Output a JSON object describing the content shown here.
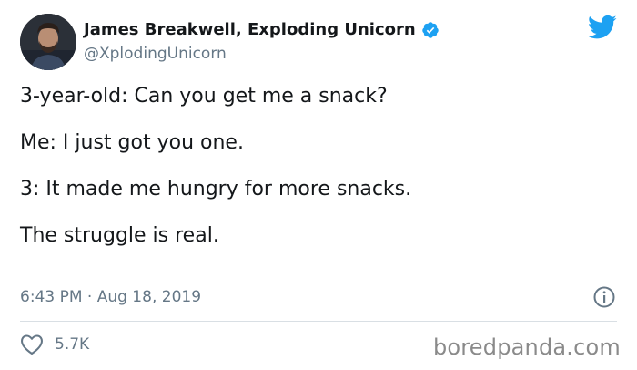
{
  "author": {
    "display_name": "James Breakwell, Exploding Unicorn",
    "handle": "@XplodingUnicorn",
    "verified": true
  },
  "tweet": {
    "lines": [
      "3-year-old: Can you get me a snack?",
      "Me: I just got you one.",
      "3: It made me hungry for more snacks.",
      "The struggle is real."
    ],
    "timestamp": "6:43 PM · Aug 18, 2019"
  },
  "engagement": {
    "likes": "5.7K"
  },
  "watermark": "boredpanda.com",
  "colors": {
    "twitter_blue": "#1da1f2",
    "text_primary": "#14171a",
    "text_secondary": "#657786",
    "divider": "#d9dfe4"
  },
  "icons": {
    "verified": "verified-badge-icon",
    "brand": "twitter-bird-icon",
    "info": "info-icon",
    "like": "heart-icon"
  }
}
